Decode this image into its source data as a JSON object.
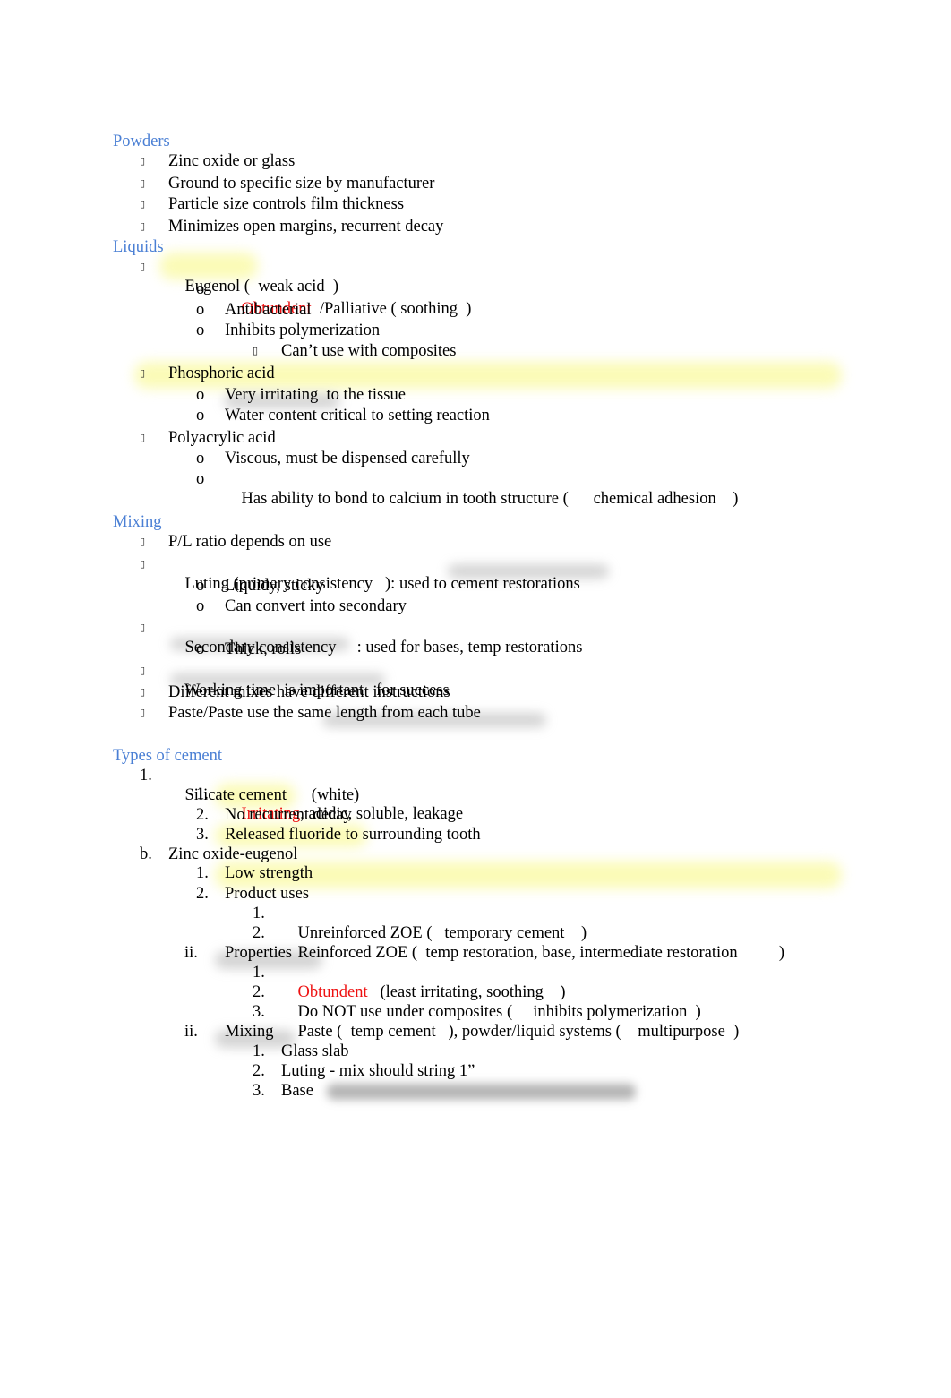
{
  "colors": {
    "heading": "#4a7fd4",
    "emphasis": "#ee1111",
    "highlight": "#fafaaa"
  },
  "icons": {
    "square_bullet": "square-bullet-icon",
    "circle_bullet": "o"
  },
  "sections": {
    "powders": {
      "title": "Powders",
      "items": [
        "Zinc oxide or glass",
        "Ground to specific size by manufacturer",
        "Particle size controls film thickness",
        "Minimizes open margins, recurrent decay"
      ]
    },
    "liquids": {
      "title": "Liquids",
      "eugenol": {
        "label_a": "Eugenol (",
        "label_b": "weak acid",
        "label_c": ")",
        "sub": {
          "obtundent": "Obtundent",
          "palliative_a": "/Palliative (",
          "palliative_b": "soothing",
          "palliative_c": ")",
          "antibacterial": "Antibacterial",
          "inhibits": "Inhibits polymerization",
          "cant_use": "Can’t use with composites"
        }
      },
      "phosphoric": {
        "label": "Phosphoric acid",
        "sub": [
          "Very irritating  to the tissue",
          "Water content critical to setting reaction"
        ]
      },
      "polyacrylic": {
        "label": "Polyacrylic acid",
        "sub_1": "Viscous, must be dispensed carefully",
        "sub_2_a": "Has ability to bond to calcium in tooth structure (",
        "sub_2_b": "chemical adhesion",
        "sub_2_c": ")"
      }
    },
    "mixing": {
      "title": "Mixing",
      "pl_ratio": "P/L ratio depends on use",
      "luting_a": "Luting",
      "luting_b": "(primary consistency",
      "luting_c": "): used to cement restorations",
      "luting_sub": [
        "Liquidy, sticky",
        "Can convert into secondary"
      ],
      "secondary_a": "Secondary consistency",
      "secondary_b": ": used for bases, temp restorations",
      "secondary_sub": "Thick, rolls",
      "working_a": "Working time",
      "working_b": "is important",
      "working_c": "for success",
      "different": "Different mixes have different instructions",
      "paste": "Paste/Paste use the same length from each tube"
    },
    "types": {
      "title": "Types of cement",
      "silicate": {
        "marker": "1.",
        "label_a": "Silicate cement",
        "label_b": "(white",
        "label_c": ")",
        "items": [
          {
            "marker": "1.",
            "red": "Irritating",
            "rest": ", acidic, soluble, leakage"
          },
          {
            "marker": "2.",
            "text": "No recurrent decay"
          },
          {
            "marker": "3.",
            "text": "Released fluoride to surrounding tooth"
          }
        ]
      },
      "zoe": {
        "marker": "b.",
        "label": "Zinc oxide-eugenol",
        "low_strength": {
          "marker": "1.",
          "text": "Low strength"
        },
        "product_uses": {
          "marker": "2.",
          "label": "Product uses",
          "items": [
            {
              "marker": "1.",
              "a": "Unreinforced ZOE (",
              "b": "temporary cement",
              "c": ")"
            },
            {
              "marker": "2.",
              "a": "Reinforced ZOE (",
              "b": "temp restoration, base, intermediate restoration",
              "c": ")"
            }
          ]
        },
        "properties": {
          "marker": "ii.",
          "label": "Properties",
          "items": [
            {
              "marker": "1.",
              "red": "Obtundent",
              "b": "(least irritating, soothing",
              "c": ")"
            },
            {
              "marker": "2.",
              "a": "Do NOT use under composites (",
              "b": "inhibits polymerization",
              "c": ")"
            },
            {
              "marker": "3.",
              "a": "Paste (",
              "b": "temp cement",
              "c": "), powder/liquid systems (",
              "d": "multipurpose",
              "e": ")"
            }
          ]
        },
        "mixing": {
          "marker": "ii.",
          "label": "Mixing",
          "items": [
            {
              "marker": "1.",
              "text": "Glass slab"
            },
            {
              "marker": "2.",
              "text": "Luting - mix should string 1”"
            },
            {
              "marker": "3.",
              "text": "Base"
            }
          ]
        }
      }
    }
  }
}
